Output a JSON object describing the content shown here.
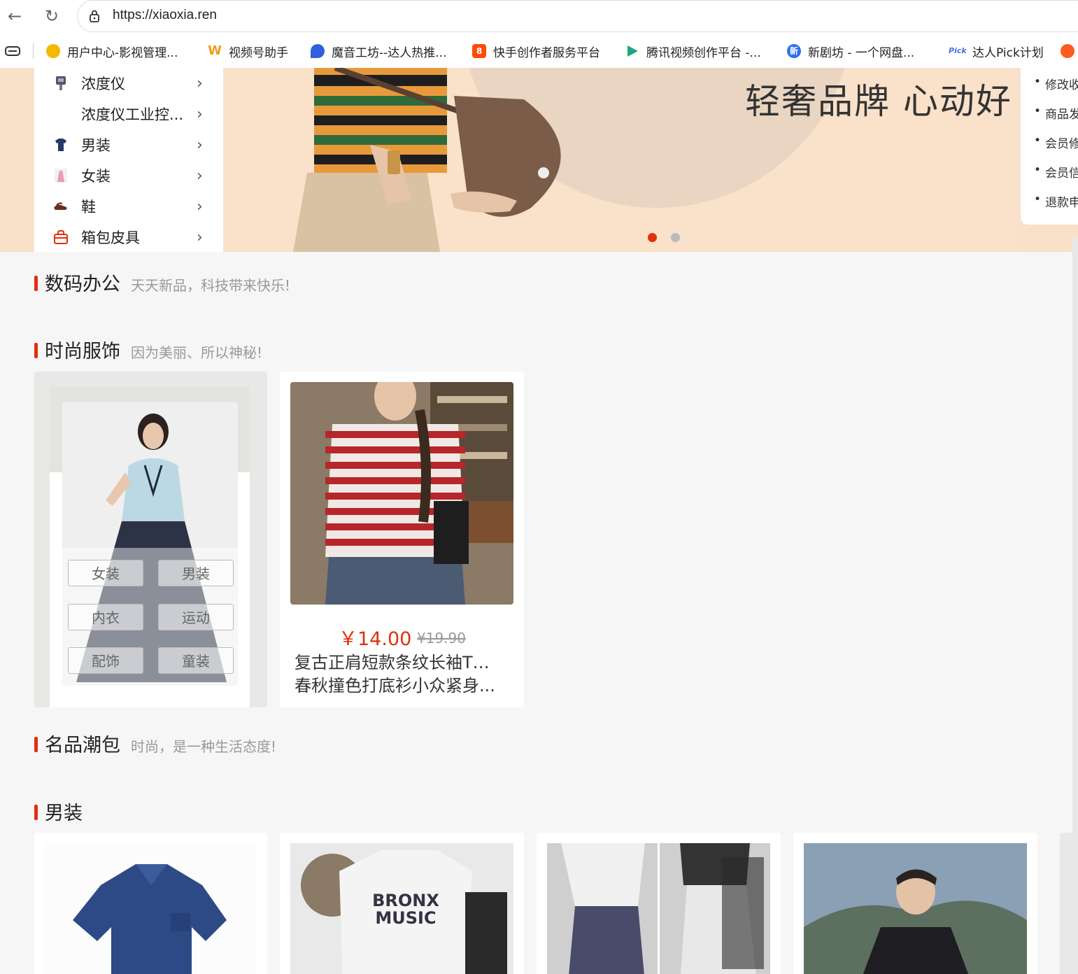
{
  "browser": {
    "url": "https://xiaoxia.ren",
    "bookmarks": [
      {
        "label": "用户中心-影视管理...",
        "color": "#f5b800",
        "icon": "fruit-icon"
      },
      {
        "label": "视频号助手",
        "color": "#f39a1e",
        "icon": "wechat-channels-icon"
      },
      {
        "label": "魔音工坊--达人热推...",
        "color": "#2f5fe0",
        "icon": "moyin-icon"
      },
      {
        "label": "快手创作者服务平台",
        "color": "#ff4906",
        "icon": "kuaishou-icon"
      },
      {
        "label": "腾讯视频创作平台 -...",
        "color": "#20b04a",
        "icon": "tencent-video-icon"
      },
      {
        "label": "新剧坊 - 一个网盘...",
        "color": "#2a6ff0",
        "icon": "xinjufang-icon"
      },
      {
        "label": "达人Pick计划",
        "color": "#4a6fe0",
        "icon": "pick-icon"
      }
    ]
  },
  "categories": [
    {
      "label": "浓度仪",
      "icon": "meter-icon"
    },
    {
      "label": "浓度仪工业控...",
      "icon": ""
    },
    {
      "label": "男装",
      "icon": "menswear-icon"
    },
    {
      "label": "女装",
      "icon": "womenswear-icon"
    },
    {
      "label": "鞋",
      "icon": "shoe-icon"
    },
    {
      "label": "箱包皮具",
      "icon": "bag-icon"
    }
  ],
  "banner": {
    "title": "轻奢品牌 心动好",
    "dots": [
      "active",
      "inactive"
    ],
    "accent": "#e0300e"
  },
  "notices": [
    "修改收",
    "商品发",
    "会员修",
    "会员信",
    "退款申"
  ],
  "sections": [
    {
      "title": "数码办公",
      "subtitle": "天天新品，科技带来快乐!"
    },
    {
      "title": "时尚服饰",
      "subtitle": "因为美丽、所以神秘!"
    },
    {
      "title": "名品潮包",
      "subtitle": "时尚，是一种生活态度!"
    },
    {
      "title": "男装",
      "subtitle": ""
    }
  ],
  "fashion_tags": [
    "女装",
    "男装",
    "内衣",
    "运动",
    "配饰",
    "童装"
  ],
  "fashion_product": {
    "price": "￥14.00",
    "old_price": "¥19.90",
    "title_line1": "复古正肩短款条纹长袖T恤女",
    "title_line2": "春秋撞色打底衫小众紧身..."
  },
  "mens_products": [
    {
      "image": "blue-shirt"
    },
    {
      "image": "bronx-music-sweatshirt",
      "print": "BRONX MUSIC"
    },
    {
      "image": "cargo-pants"
    },
    {
      "image": "black-jacket"
    }
  ]
}
